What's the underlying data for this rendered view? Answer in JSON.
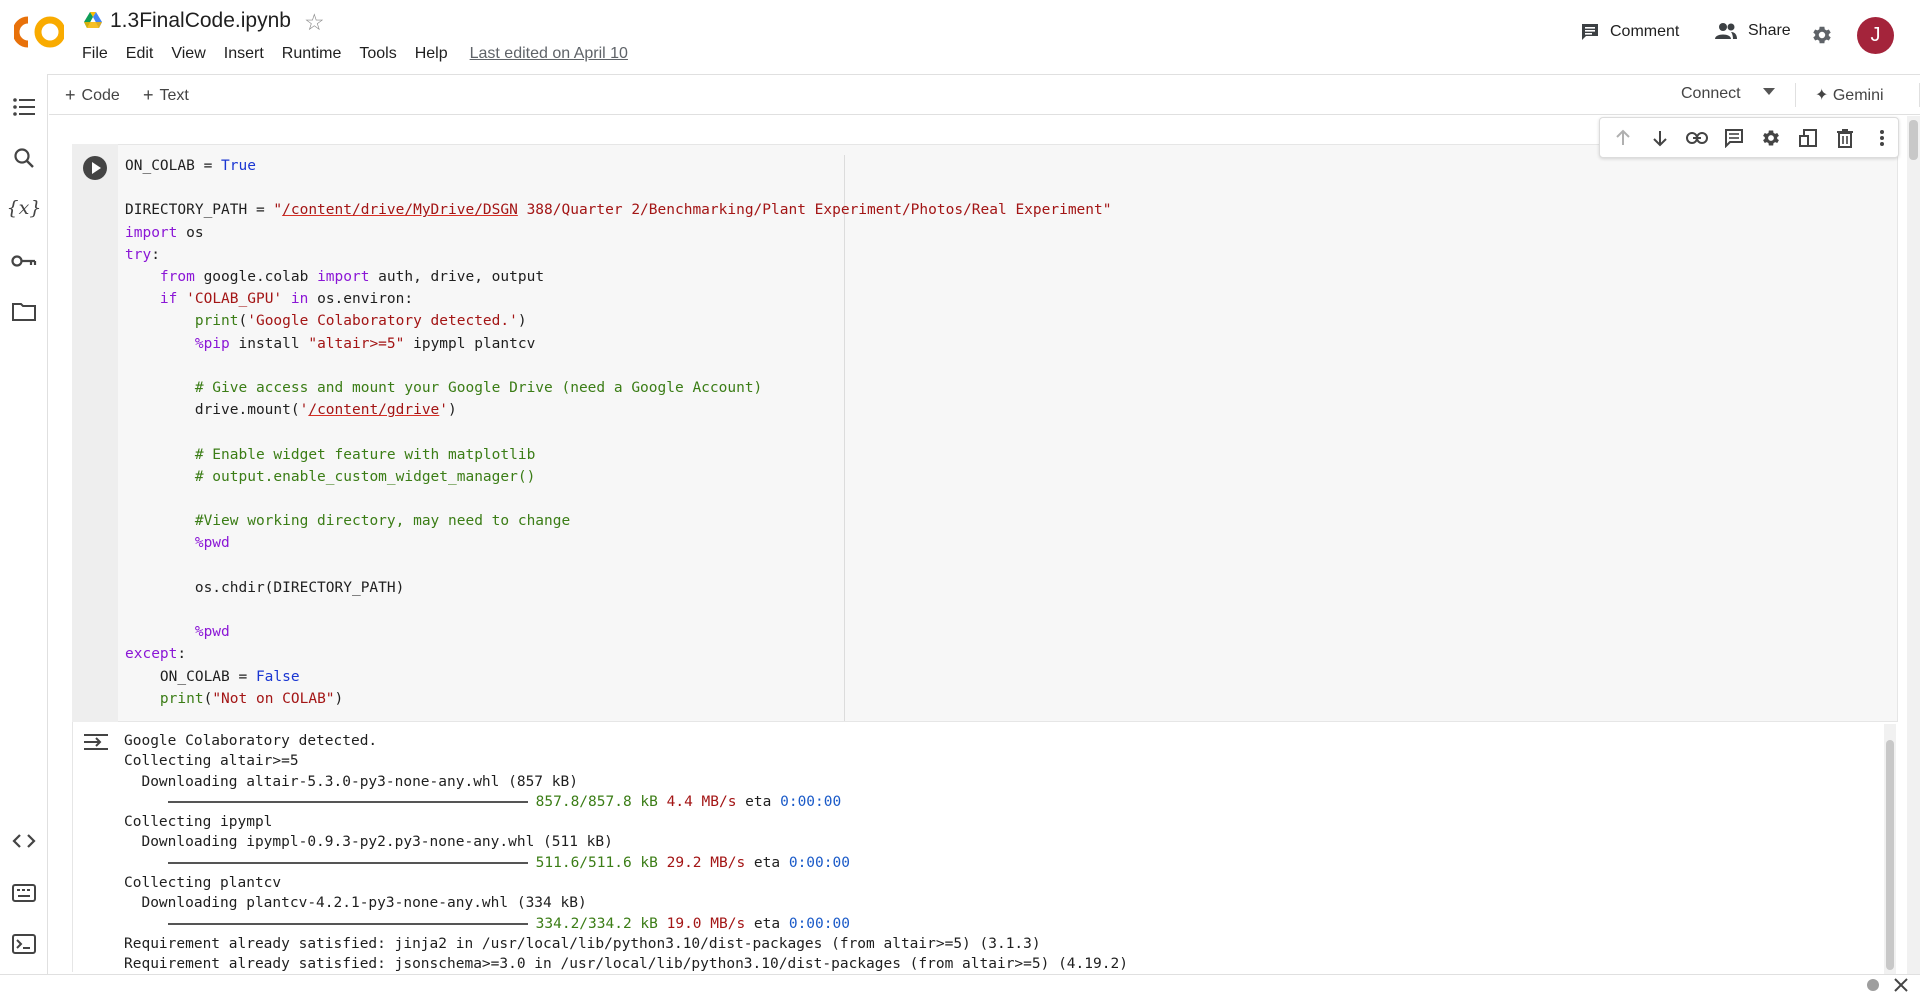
{
  "header": {
    "title": "1.3FinalCode.ipynb",
    "menu": [
      "File",
      "Edit",
      "View",
      "Insert",
      "Runtime",
      "Tools",
      "Help"
    ],
    "last_edited": "Last edited on April 10",
    "comment_label": "Comment",
    "share_label": "Share",
    "avatar_letter": "J"
  },
  "toolbar": {
    "add_code": "Code",
    "add_text": "Text",
    "connect": "Connect",
    "gemini": "Gemini"
  },
  "cell": {
    "code_lines": [
      "ON_COLAB = True",
      "",
      "DIRECTORY_PATH = \"/content/drive/MyDrive/DSGN 388/Quarter 2/Benchmarking/Plant Experiment/Photos/Real Experiment\"",
      "import os",
      "try:",
      "    from google.colab import auth, drive, output",
      "    if 'COLAB_GPU' in os.environ:",
      "        print('Google Colaboratory detected.')",
      "        %pip install \"altair>=5\" ipympl plantcv",
      "",
      "        # Give access and mount your Google Drive (need a Google Account)",
      "        drive.mount('/content/gdrive')",
      "",
      "        # Enable widget feature with matplotlib",
      "        # output.enable_custom_widget_manager()",
      "",
      "        #View working directory, may need to change",
      "        %pwd",
      "",
      "        os.chdir(DIRECTORY_PATH)",
      "",
      "        %pwd",
      "except:",
      "    ON_COLAB = False",
      "    print(\"Not on COLAB\")"
    ]
  },
  "output": {
    "lines": [
      "Google Colaboratory detected.",
      "Collecting altair>=5",
      "  Downloading altair-5.3.0-py3-none-any.whl (857 kB)",
      {
        "progress": "857.8/857.8 kB",
        "speed": "4.4 MB/s",
        "eta_label": "eta",
        "eta": "0:00:00"
      },
      "Collecting ipympl",
      "  Downloading ipympl-0.9.3-py2.py3-none-any.whl (511 kB)",
      {
        "progress": "511.6/511.6 kB",
        "speed": "29.2 MB/s",
        "eta_label": "eta",
        "eta": "0:00:00"
      },
      "Collecting plantcv",
      "  Downloading plantcv-4.2.1-py3-none-any.whl (334 kB)",
      {
        "progress": "334.2/334.2 kB",
        "speed": "19.0 MB/s",
        "eta_label": "eta",
        "eta": "0:00:00"
      },
      "Requirement already satisfied: jinja2 in /usr/local/lib/python3.10/dist-packages (from altair>=5) (3.1.3)",
      "Requirement already satisfied: jsonschema>=3.0 in /usr/local/lib/python3.10/dist-packages (from altair>=5) (4.19.2)"
    ]
  },
  "colors": {
    "accent_avatar": "#a4243b",
    "keyword": "#8b17d6",
    "string": "#a31515",
    "comment": "#3b7d16"
  }
}
